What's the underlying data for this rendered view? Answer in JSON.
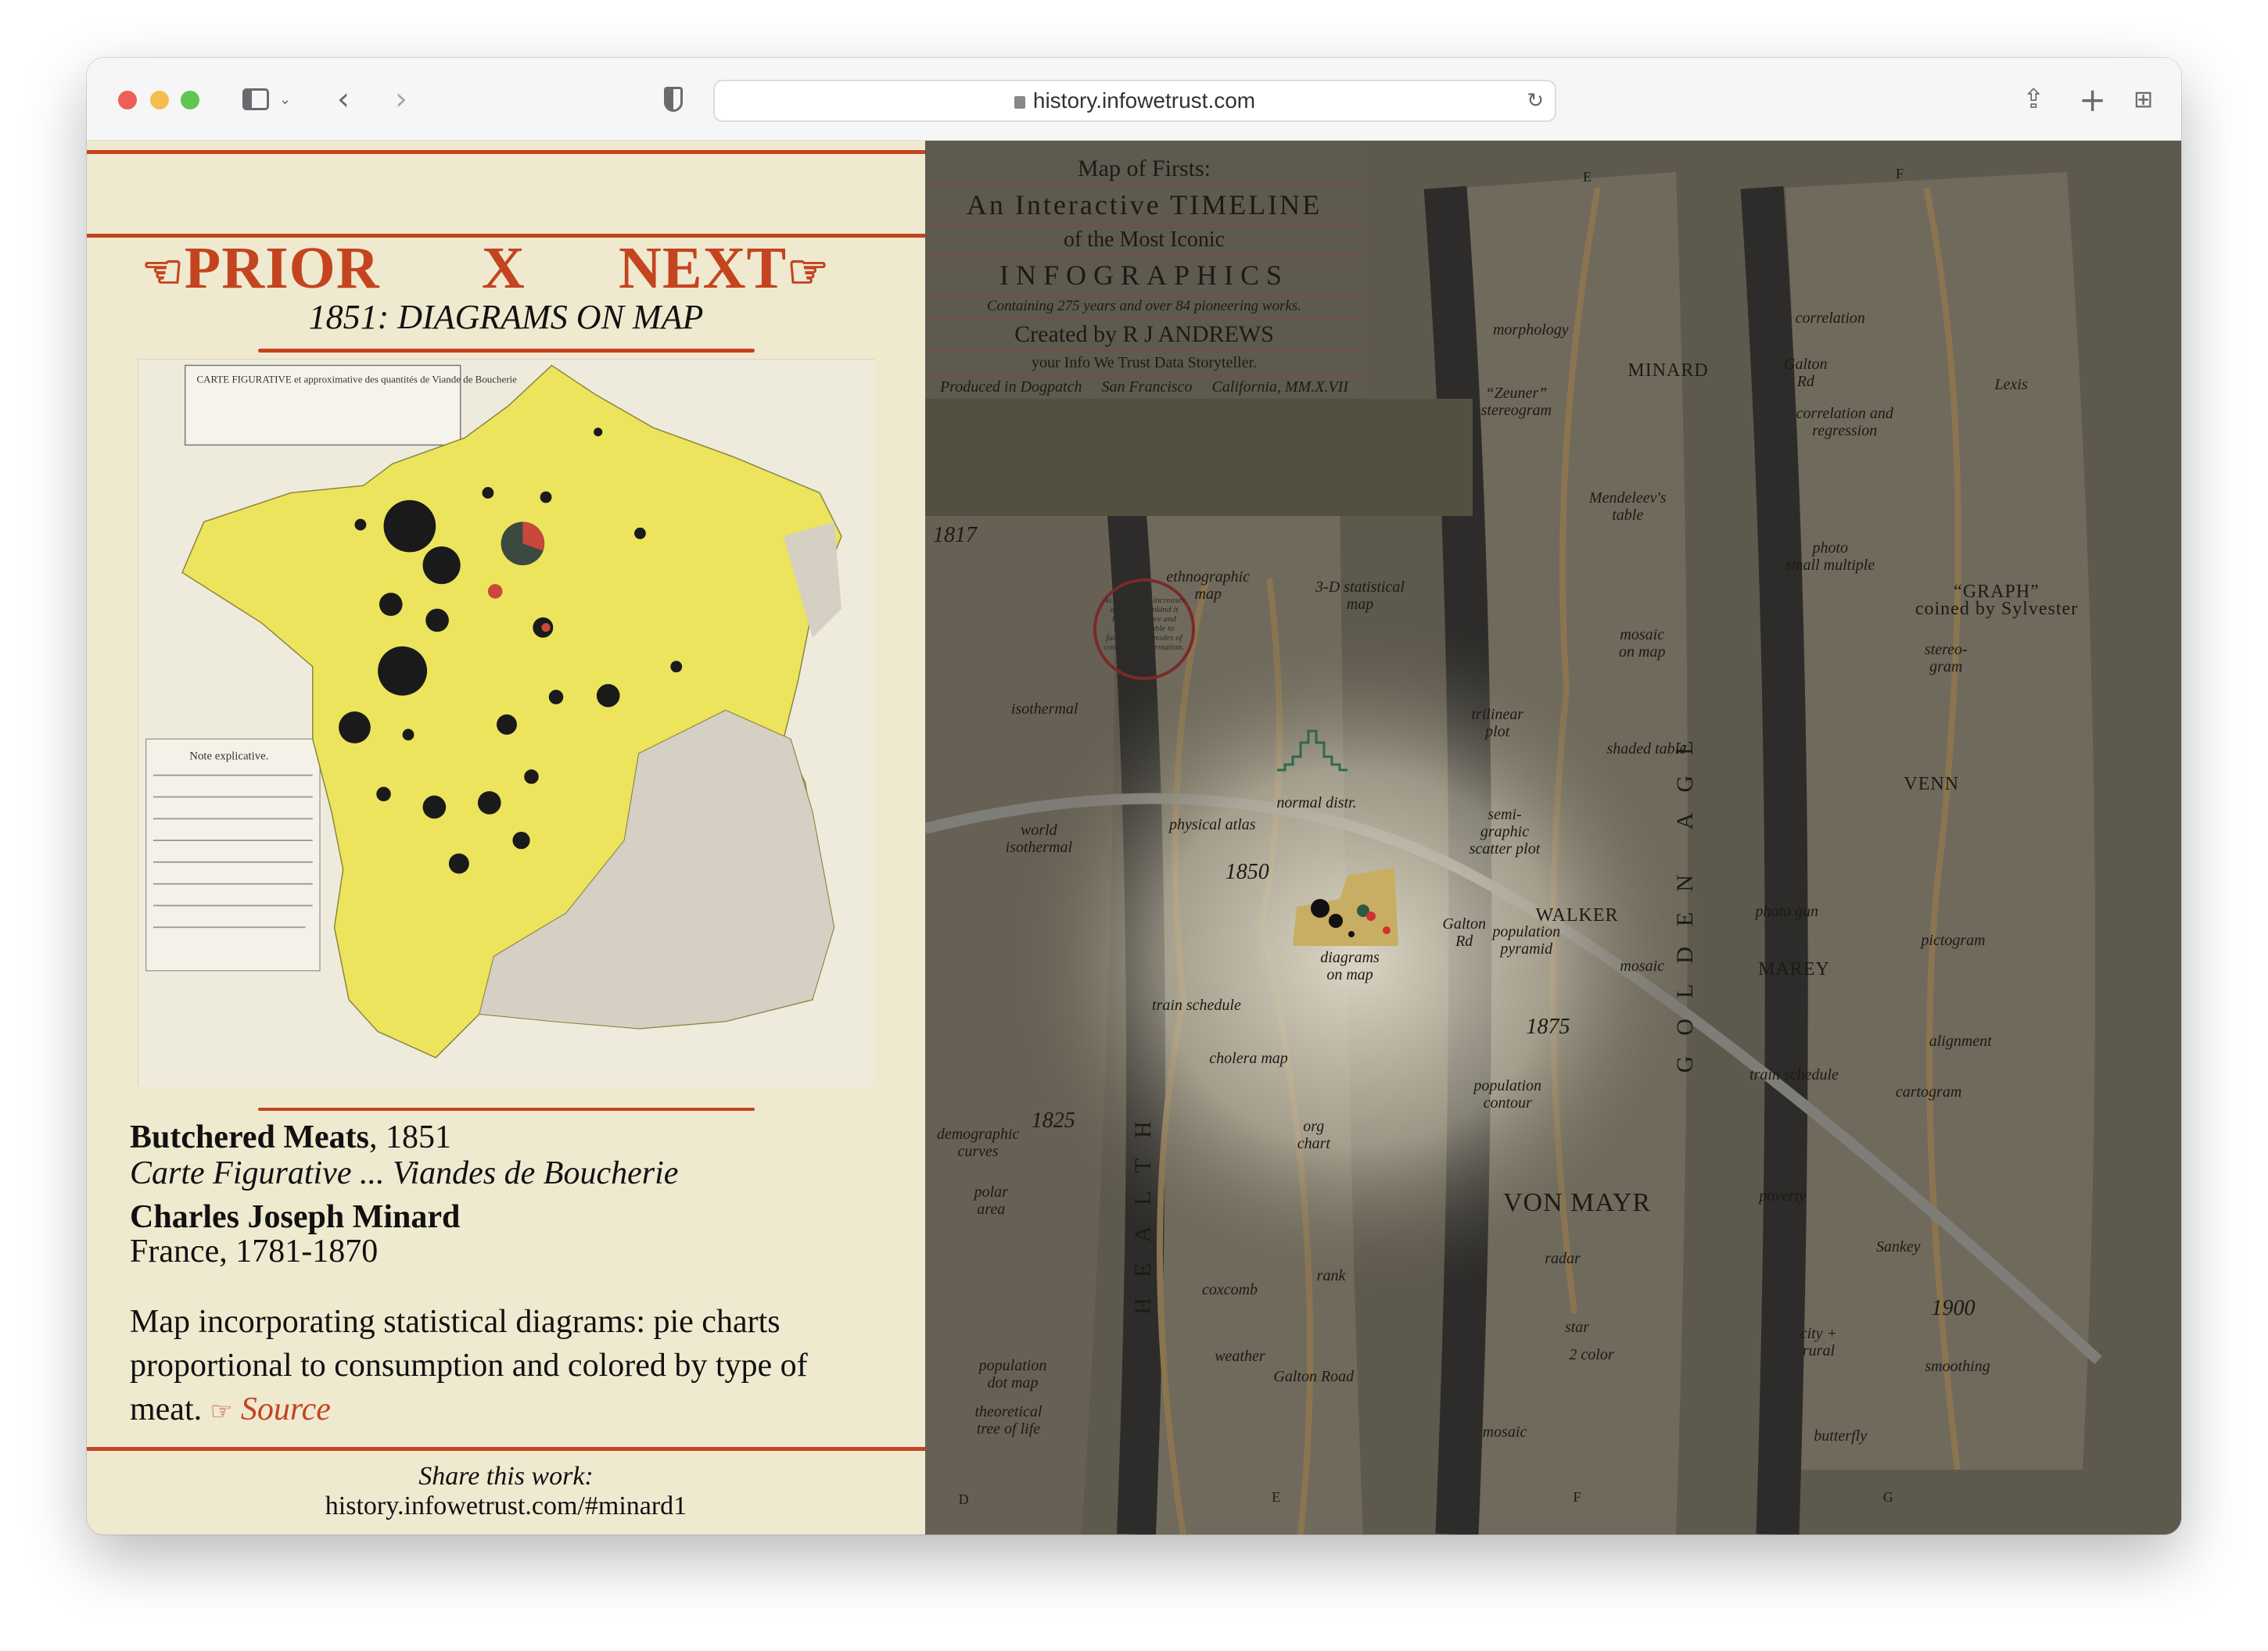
{
  "browser": {
    "url": "history.infowetrust.com",
    "icons": [
      "sidebar-icon",
      "chevron-down-icon",
      "back-icon",
      "forward-icon",
      "shield-icon",
      "lock-icon",
      "reload-icon",
      "share-icon",
      "new-tab-icon",
      "tab-overview-icon"
    ]
  },
  "nav": {
    "prior": "PRIOR",
    "close": "X",
    "next": "NEXT",
    "hand_left": "☜",
    "hand_right": "☞"
  },
  "entry": {
    "heading": "1851: DIAGRAMS ON MAP",
    "work_title": "Butchered Meats",
    "work_year": ", 1851",
    "work_subtitle": "Carte Figurative ... Viandes de Boucherie",
    "author": "Charles Joseph Minard",
    "author_info": "France, 1781-1870",
    "description": "Map incorporating statistical diagrams: pie charts proportional to consumption and colored by type of meat.",
    "source_icon": "☞",
    "source_label": "Source",
    "share_label": "Share this work:",
    "share_url": "history.infowetrust.com/#minard1",
    "figure_caption": "CARTE FIGURATIVE et approximative des quantités de Viande de Boucherie",
    "figure_note": "Note explicative."
  },
  "colors": {
    "accent": "#c4441f",
    "paper": "#efe9d0",
    "map_yellow": "#ece45c"
  },
  "map": {
    "header": [
      "Map of Firsts:",
      "An Interactive TIMELINE",
      "of the Most Iconic",
      "INFOGRAPHICS",
      "Containing 275 years and over 84 pioneering works.",
      "Created by R J ANDREWS",
      "your Info We Trust Data Storyteller.",
      "Produced in Dogpatch     San Francisco     California, MM.X.VII"
    ],
    "quote": "As knowledge increases amongst mankind it becomes more and more desirable to facilitate the modes of conveying information.",
    "labels": [
      "morphology",
      "MINARD",
      "“Zeuner”\nstereogram",
      "correlation",
      "Lexis",
      "correlation and\nregression",
      "Mendeleev's\ntable",
      "photo\nsmall multiple",
      "“GRAPH”\ncoined by Sylvester",
      "ethnographic\nmap",
      "3-D statistical\nmap",
      "mosaic\non map",
      "isothermal",
      "trilinear\nplot",
      "shaded table",
      "stereo-\ngram",
      "normal distr.",
      "physical atlas",
      "VENN",
      "world\nisothermal",
      "semi-\ngraphic\nscatter plot",
      "1850",
      "photo gun",
      "pictogram",
      "WALKER",
      "population\npyramid",
      "mosaic",
      "diagrams\non map",
      "MAREY",
      "train schedule",
      "1875",
      "alignment",
      "train schedule",
      "cholera map",
      "population\ncontour",
      "cartogram",
      "1825",
      "demographic\ncurves",
      "org\nchart",
      "poverty",
      "VON MAYR",
      "polar\narea",
      "Sankey",
      "radar",
      "coxcomb",
      "rank",
      "1900",
      "star",
      "2 color",
      "city +\nrural",
      "smoothing",
      "weather",
      "population\ndot map",
      "theoretical\ntree of life",
      "Galton Road",
      "mosaic",
      "butterfly",
      "1817",
      "GOLDEN AGE",
      "HEALTH",
      "D",
      "E",
      "F",
      "G",
      "E",
      "F",
      "Galton\nRd",
      "Galton\nRd"
    ]
  }
}
